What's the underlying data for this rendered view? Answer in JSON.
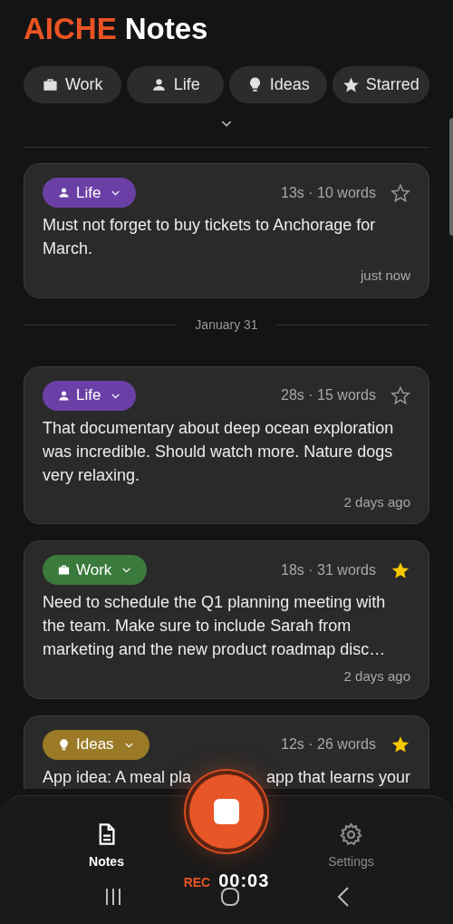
{
  "app_title": {
    "brand": "AICHE",
    "title": "Notes"
  },
  "filters": [
    {
      "kind": "work",
      "label": "Work"
    },
    {
      "kind": "life",
      "label": "Life"
    },
    {
      "kind": "ideas",
      "label": "Ideas"
    },
    {
      "kind": "starred",
      "label": "Starred"
    }
  ],
  "feed": [
    {
      "kind": "note",
      "category": {
        "kind": "life",
        "label": "Life",
        "color": "#6b40a6"
      },
      "meta": "13s · 10 words",
      "starred": false,
      "text": "Must not forget to buy tickets to Anchorage for March.",
      "time": "just now"
    },
    {
      "kind": "date_divider",
      "label": "January 31"
    },
    {
      "kind": "note",
      "category": {
        "kind": "life",
        "label": "Life",
        "color": "#6b40a6"
      },
      "meta": "28s · 15 words",
      "starred": false,
      "text": "That documentary about deep ocean exploration was incredible. Should watch more. Nature dogs very relaxing.",
      "time": "2 days ago"
    },
    {
      "kind": "note",
      "category": {
        "kind": "work",
        "label": "Work",
        "color": "#3b7a3d"
      },
      "meta": "18s · 31 words",
      "starred": true,
      "text": "Need to schedule the Q1 planning meeting with the team. Make sure to include Sarah from marketing and the new product roadmap disc…",
      "time": "2 days ago"
    },
    {
      "kind": "note",
      "category": {
        "kind": "ideas",
        "label": "Ideas",
        "color": "#9a7a26"
      },
      "meta": "12s · 26 words",
      "starred": true,
      "text": [
        "App idea: A meal pla",
        "app that learns your"
      ]
    }
  ],
  "bottom_nav": {
    "tabs": [
      {
        "kind": "notes",
        "label": "Notes",
        "selected": true
      },
      {
        "kind": "settings",
        "label": "Settings",
        "selected": false
      }
    ],
    "recording": {
      "label": "REC",
      "timer": "00:03"
    }
  }
}
